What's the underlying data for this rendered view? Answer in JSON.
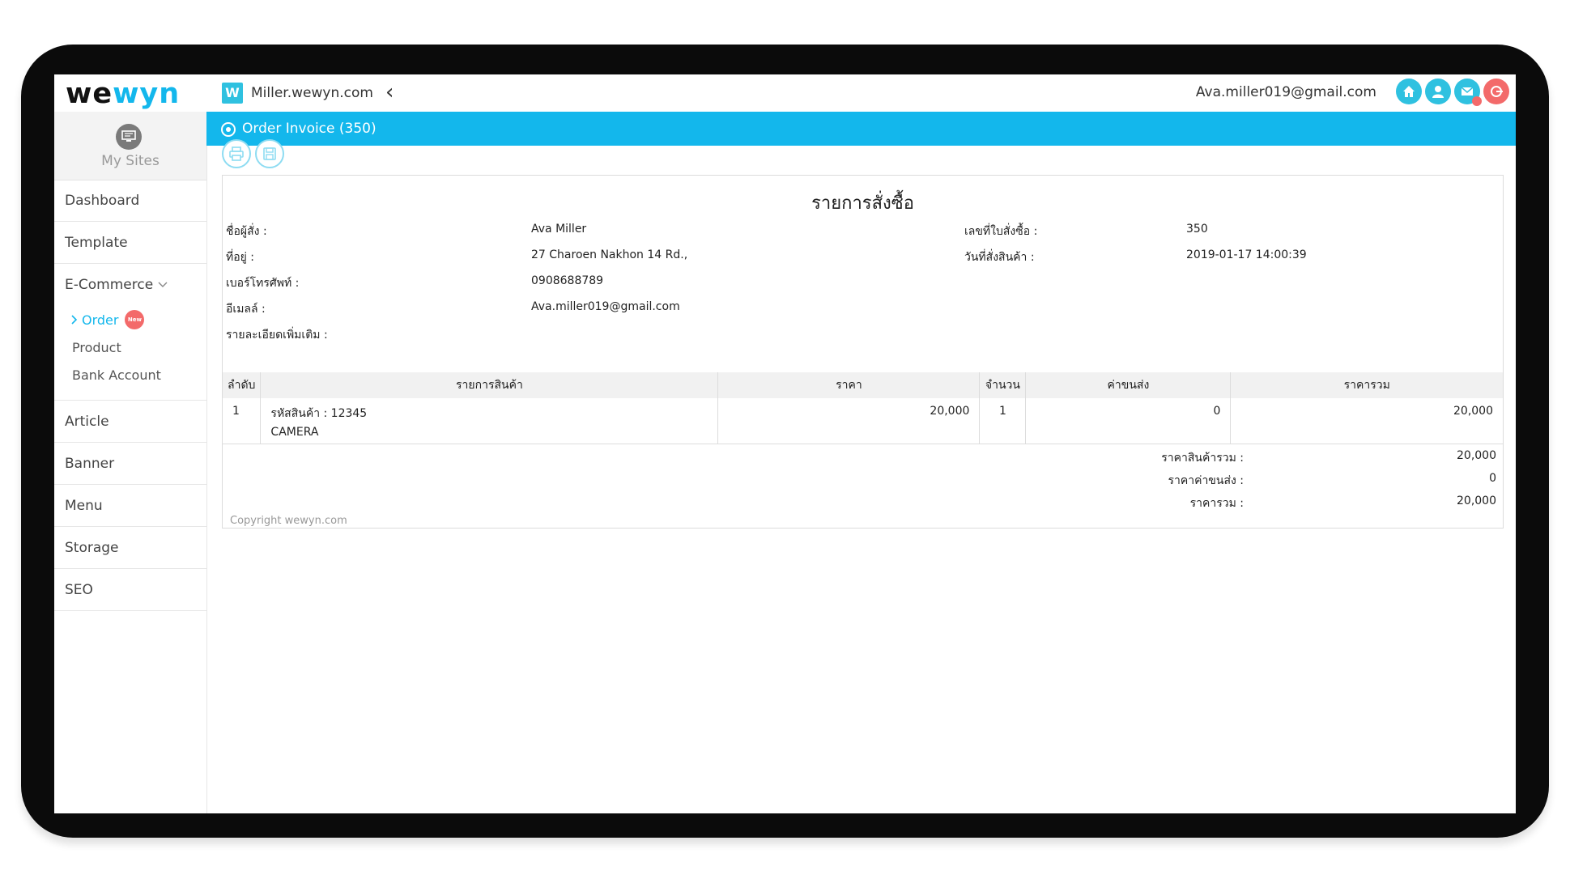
{
  "header": {
    "logo_we": "we",
    "logo_wyn": "wyn",
    "site_favicon": "W",
    "site_name": "Miller.wewyn.com",
    "back_icon": "‹",
    "user_email": "Ava.miller019@gmail.com",
    "icons": [
      "home-icon",
      "user-icon",
      "mail-icon",
      "logout-icon"
    ]
  },
  "sidebar": {
    "mysites_label": "My Sites",
    "items": [
      {
        "label": "Dashboard"
      },
      {
        "label": "Template"
      }
    ],
    "ecommerce": {
      "label": "E-Commerce",
      "children": [
        {
          "label": "Order",
          "badge": "New",
          "active": true
        },
        {
          "label": "Product"
        },
        {
          "label": "Bank Account"
        }
      ]
    },
    "items_after": [
      {
        "label": "Article"
      },
      {
        "label": "Banner"
      },
      {
        "label": "Menu"
      },
      {
        "label": "Storage"
      },
      {
        "label": "SEO"
      }
    ]
  },
  "page": {
    "title": "Order Invoice (350)",
    "tools": [
      "print-icon",
      "save-icon"
    ]
  },
  "invoice": {
    "title": "รายการสั่งซื้อ",
    "buyer_label": "ชื่อผู้สั่ง :",
    "buyer_value": "Ava Miller",
    "address_label": "ที่อยู่ :",
    "address_value": "27 Charoen Nakhon 14 Rd.,",
    "phone_label": "เบอร์โทรศัพท์ :",
    "phone_value": "0908688789",
    "email_label": "อีเมลล์ :",
    "email_value": "Ava.miller019@gmail.com",
    "details_label": "รายละเอียดเพิ่มเติม :",
    "order_no_label": "เลขที่ใบสั่งซื้อ :",
    "order_no_value": "350",
    "order_date_label": "วันที่สั่งสินค้า :",
    "order_date_value": "2019-01-17 14:00:39",
    "columns": [
      "ลำดับ",
      "รายการสินค้า",
      "ราคา",
      "จำนวน",
      "ค่าขนส่ง",
      "ราคารวม"
    ],
    "rows": [
      {
        "no": "1",
        "code": "รหัสสินค้า : 12345",
        "name": "CAMERA",
        "price": "20,000",
        "qty": "1",
        "shipping": "0",
        "total": "20,000"
      }
    ],
    "summary": {
      "subtotal_label": "ราคาสินค้ารวม :",
      "subtotal_value": "20,000",
      "shipping_label": "ราคาค่าขนส่ง :",
      "shipping_value": "0",
      "total_label": "ราคารวม :",
      "total_value": "20,000"
    },
    "copyright": "Copyright wewyn.com"
  }
}
